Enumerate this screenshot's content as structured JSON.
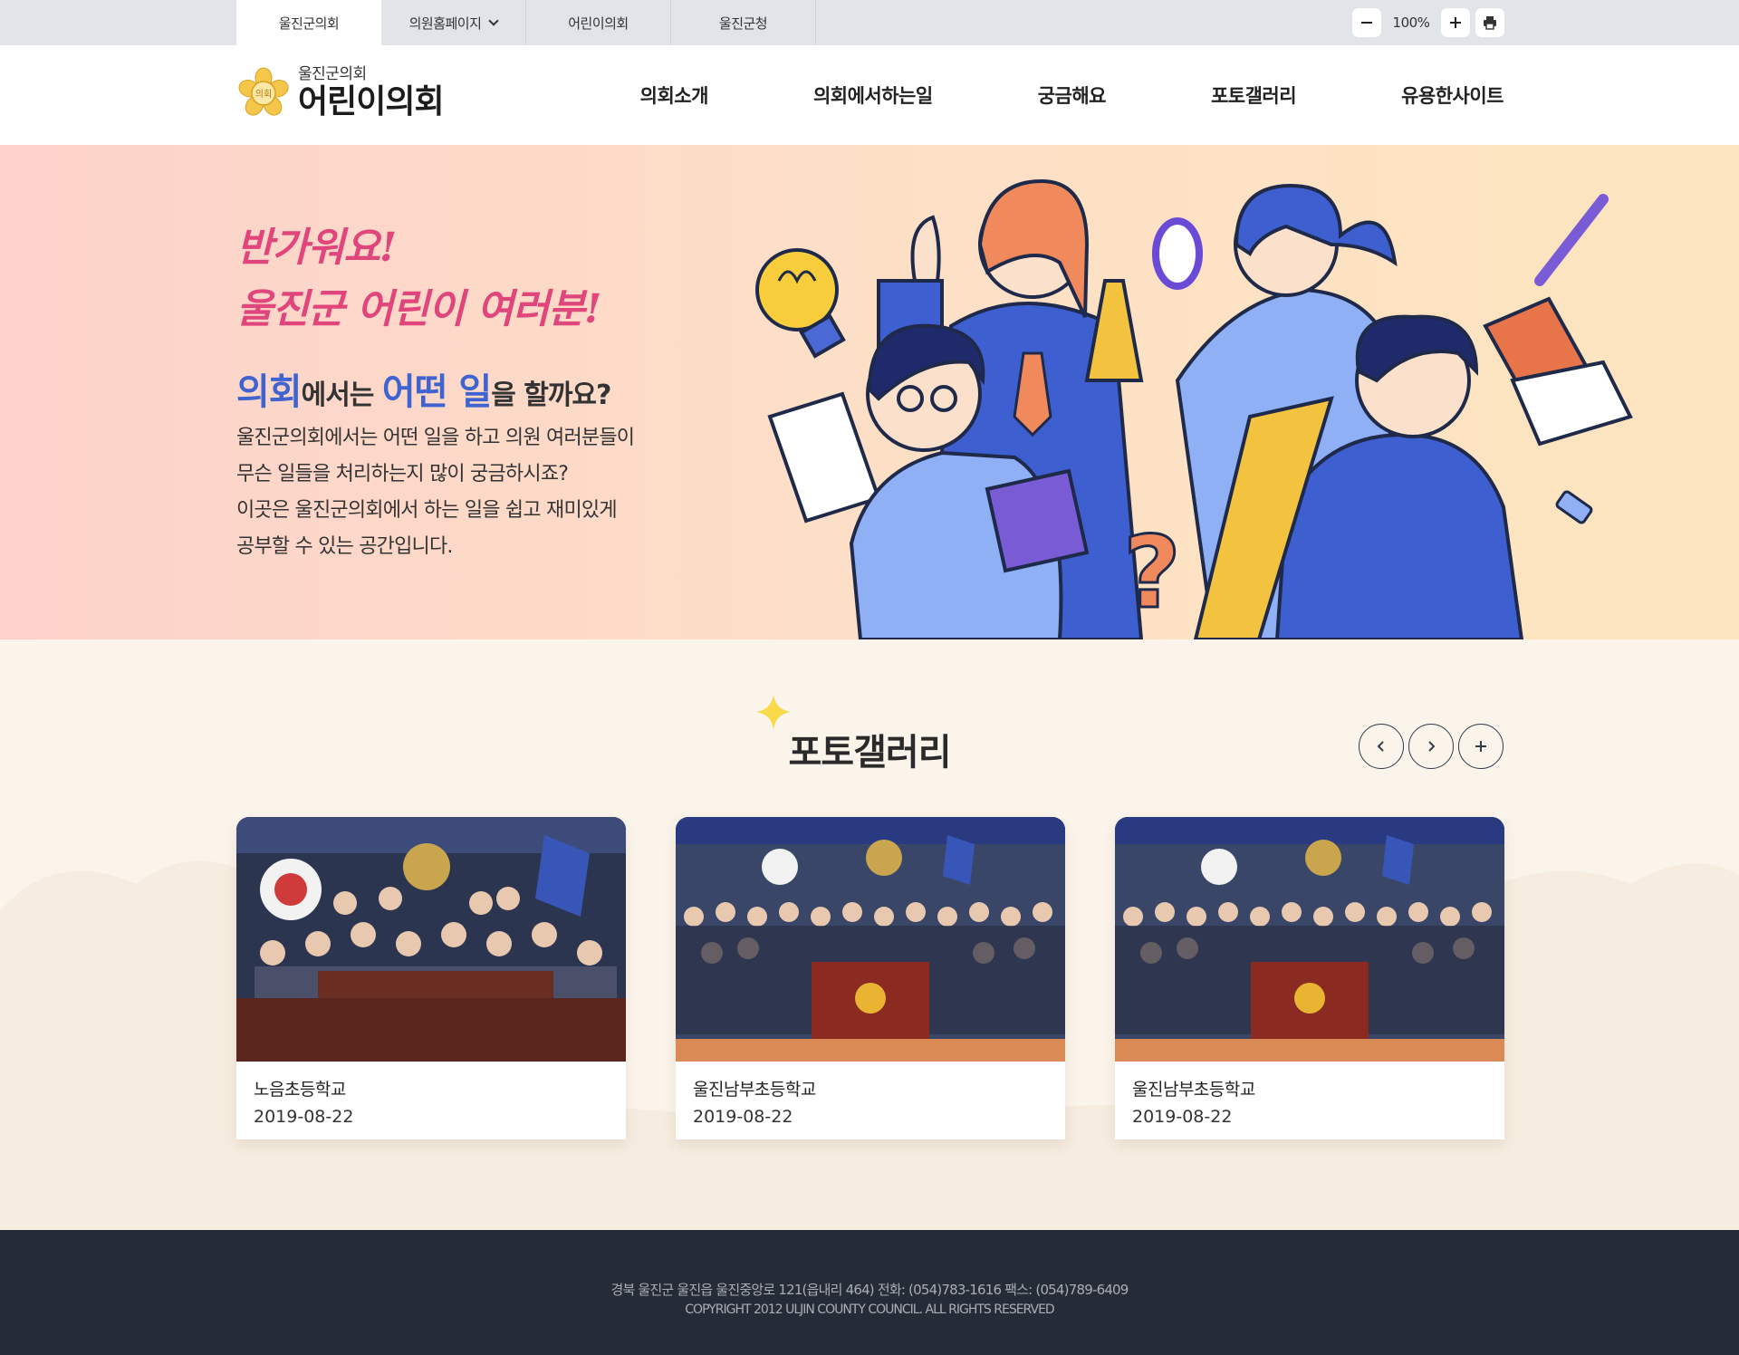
{
  "util_tabs": [
    {
      "label": "울진군의회",
      "active": true
    },
    {
      "label": "의원홈페이지",
      "has_dropdown": true
    },
    {
      "label": "어린이의회"
    },
    {
      "label": "울진군청"
    }
  ],
  "zoom": {
    "value": "100%",
    "minus_icon": "minus-icon",
    "plus_icon": "plus-icon",
    "print_icon": "print-icon"
  },
  "logo": {
    "sub": "울진군의회",
    "main": "어린이의회",
    "seal_text": "의회"
  },
  "gnb": [
    "의회소개",
    "의회에서하는일",
    "궁금해요",
    "포토갤러리",
    "유용한사이트"
  ],
  "hero": {
    "hello_line1": "반가워요!",
    "hello_line2": "울진군 어린이 여러분!",
    "q_part1": "의회",
    "q_part2": "에서는 ",
    "q_part3": "어떤 일",
    "q_part4": "을 할까요?",
    "desc": [
      "울진군의회에서는 어떤 일을 하고 의원 여러분들이",
      "무슨 일들을 처리하는지 많이 궁금하시죠?",
      "이곳은 울진군의회에서 하는 일을 쉽고 재미있게",
      "공부할 수 있는 공간입니다."
    ]
  },
  "gallery": {
    "title": "포토갤러리",
    "cards": [
      {
        "title": "노음초등학교",
        "date": "2019-08-22"
      },
      {
        "title": "울진남부초등학교",
        "date": "2019-08-22"
      },
      {
        "title": "울진남부초등학교",
        "date": "2019-08-22"
      }
    ]
  },
  "footer": {
    "address": "경북 울진군 울진읍 울진중앙로 121(읍내리 464) 전화: (054)783-1616 팩스: (054)789-6409",
    "copyright": "COPYRIGHT   2012 ULJIN COUNTY COUNCIL. ALL RIGHTS RESERVED"
  },
  "colors": {
    "accent_pink": "#e0457b",
    "accent_blue": "#3f63cf",
    "footer_bg": "#262c37",
    "utilbar_bg": "#e1e4e8"
  }
}
